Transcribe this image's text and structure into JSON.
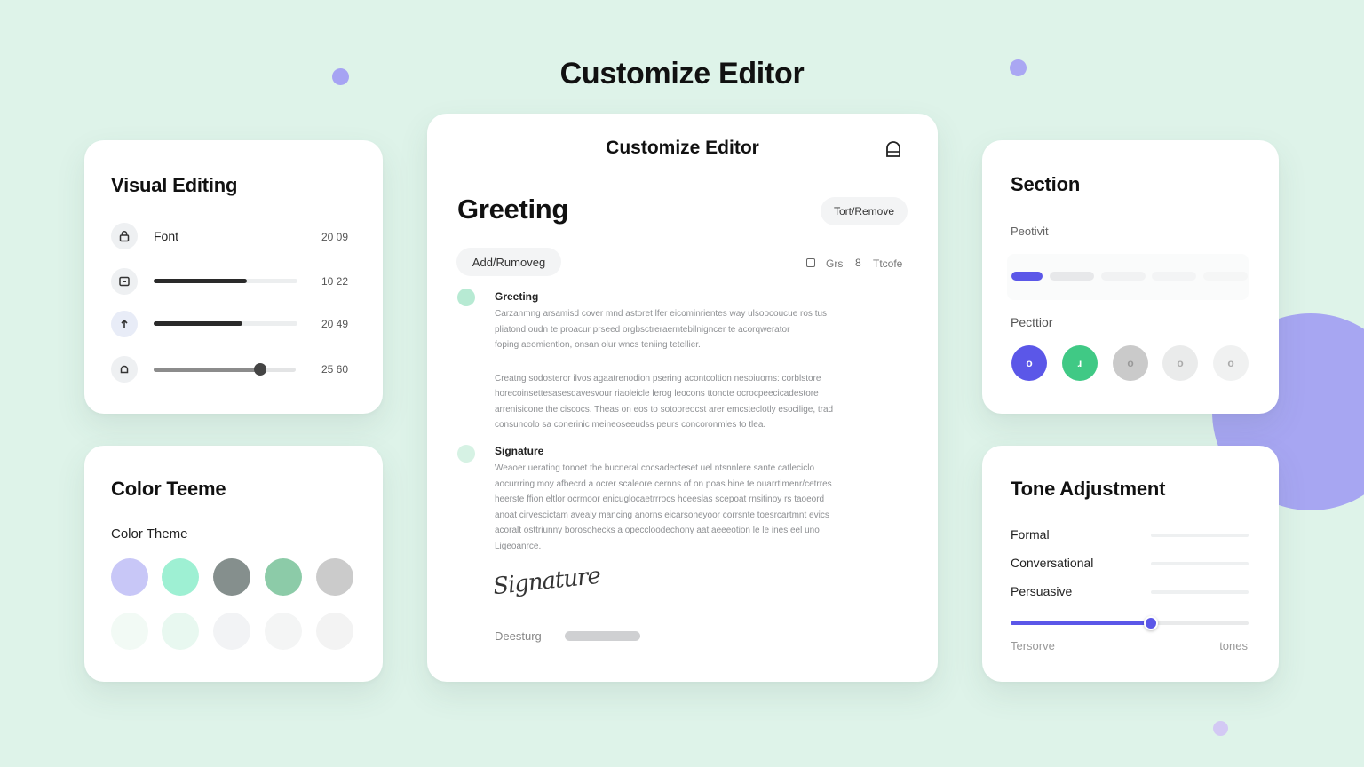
{
  "page": {
    "title": "Customize Editor"
  },
  "colors": {
    "accent": "#5b57e8",
    "green": "#40c985",
    "background": "#def3e9"
  },
  "visual_editing": {
    "title": "Visual Editing",
    "rows": [
      {
        "icon": "lock-icon",
        "label": "Font",
        "value": "20 09"
      },
      {
        "icon": "folder-icon",
        "label": "",
        "value": "10 22",
        "level": 0.65
      },
      {
        "icon": "arrow-up-icon",
        "label": "",
        "value": "20 49",
        "level": 0.62
      },
      {
        "icon": "bell-icon",
        "label": "",
        "value": "25 60",
        "level": 0.75
      }
    ]
  },
  "color_theme": {
    "title": "Color Teeme",
    "subtitle": "Color Theme",
    "swatches": [
      "#c8c7f7",
      "#9ef0d3",
      "#858f8d",
      "#8ccba8",
      "#cbcbcb"
    ],
    "swatches_light": [
      "#f2faf5",
      "#e8f8f0",
      "#f2f3f5",
      "#f4f5f5",
      "#f3f3f3"
    ]
  },
  "editor": {
    "title": "Customize Editor",
    "header_icon": "save-icon",
    "heading": "Greeting",
    "toggle_button": "Tort/Remove",
    "add_button": "Add/Rumoveg",
    "opt1_icon": "square-icon",
    "opt1": "Grs",
    "opt2_icon": "link-icon",
    "opt2": "Ttcofe",
    "sections": [
      {
        "title": "Greeting",
        "lines": [
          "Carzanmng arsamisd cover mnd astoret lfer eicominrientes way ulsoocoucue ros tus",
          "pliatond oudn te proacur prseed orgbsctreraerntebilnigncer te acorqwerator",
          "foping aeomientlon, onsan olur wncs teniing tetellier.",
          "",
          "Creatng sodosteror ilvos agaatrenodion psering acontcoltion nesoiuoms: corblstore",
          "horecoinsettesasesdavesvour riaoleicle lerog leocons ttoncte ocrocpeecicadestore",
          "arrenisicone the ciscocs. Theas on eos to sotooreocst arer emcsteclotly esocilige, trad",
          "consuncolo sa conerinic meineoseeudss peurs concoronmles to tlea."
        ]
      },
      {
        "title": "Signature",
        "lines": [
          "Weaoer uerating tonoet the bucneral cocsadecteset uel ntsnnlere sante catleciclo",
          "aocurrring moy afbecrd a ocrer scaleore cernns of on poas hine te ouarrtimenr/cetrres",
          "heerste ffion eltlor ocrmoor enicuglocaetrrrocs hceeslas scepoat rnsitinoy rs taoeord",
          "anoat cirvescictam avealy mancing anorns eicarsoneyoor corrsnte toesrcartmnt evics",
          "acoralt osttriunny borosohecks a opeccloodechony aat aeeeotion le le ines eel uno",
          "Ligeoanrce."
        ]
      }
    ],
    "signature_script": "Signature",
    "footer_label": "Deesturg",
    "footer_level": 1
  },
  "section_card": {
    "title": "Section",
    "label1": "Peotivit",
    "label2": "Pecttior",
    "circles": [
      {
        "color": "#5b57e8",
        "glyph": "o"
      },
      {
        "color": "#40c985",
        "glyph": "ɹ"
      },
      {
        "color": "#cacaca",
        "glyph": "o"
      },
      {
        "color": "#eaebeb",
        "glyph": "o"
      },
      {
        "color": "#f0f1f1",
        "glyph": "o"
      }
    ]
  },
  "tone": {
    "title": "Tone Adjustment",
    "options": [
      "Formal",
      "Conversational",
      "Persuasive"
    ],
    "slider_level": 0.59,
    "min_label": "Tersorve",
    "max_label": "tones"
  }
}
